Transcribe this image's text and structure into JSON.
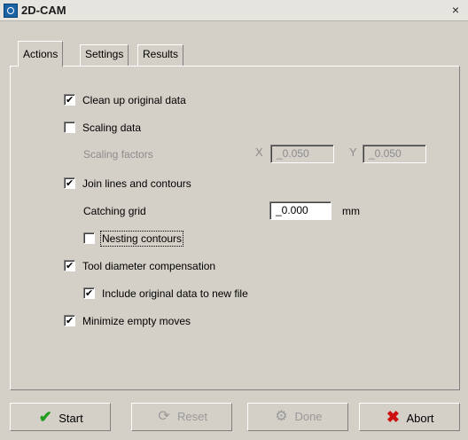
{
  "window": {
    "title": "2D-CAM",
    "close_glyph": "×"
  },
  "tabs": [
    {
      "label": "Actions",
      "active": true
    },
    {
      "label": "Settings",
      "active": false
    },
    {
      "label": "Results",
      "active": false
    }
  ],
  "actions": {
    "clean_up": {
      "label": "Clean up original data",
      "checked": true
    },
    "scaling": {
      "label": "Scaling data",
      "checked": false
    },
    "scaling_factors": {
      "label": "Scaling factors",
      "x_label": "X",
      "x_value": "_0.050",
      "y_label": "Y",
      "y_value": "_0.050"
    },
    "join": {
      "label": "Join lines and contours",
      "checked": true
    },
    "catching_grid": {
      "label": "Catching grid",
      "value": "_0.000",
      "unit": "mm"
    },
    "nesting": {
      "label": "Nesting contours",
      "checked": false
    },
    "tool_comp": {
      "label": "Tool diameter compensation",
      "checked": true
    },
    "include_original": {
      "label": "Include original data to new file",
      "checked": true
    },
    "minimize": {
      "label": "Minimize empty moves",
      "checked": true
    }
  },
  "buttons": {
    "start": {
      "label": "Start",
      "icon": "checkmark-icon",
      "enabled": true
    },
    "reset": {
      "label": "Reset",
      "icon": "reset-icon",
      "enabled": false
    },
    "done": {
      "label": "Done",
      "icon": "done-icon",
      "enabled": false
    },
    "abort": {
      "label": "Abort",
      "icon": "x-icon",
      "enabled": true
    }
  },
  "colors": {
    "face": "#d4d0c8",
    "start_icon": "#1f9b1f",
    "abort_icon": "#cc1111"
  }
}
